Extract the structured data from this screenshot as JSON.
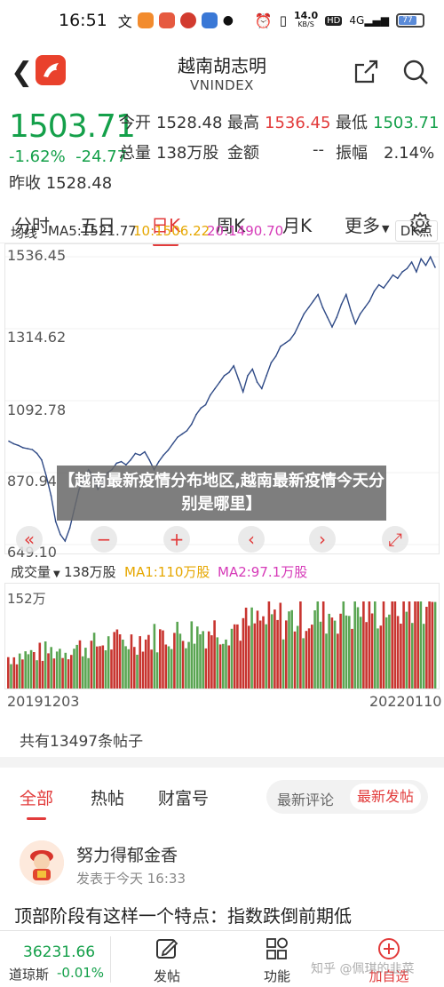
{
  "status": {
    "time": "16:51",
    "net_speed_top": "14.0",
    "net_speed_unit": "KB/S",
    "hd_label": "HD",
    "signal_label": "4G",
    "battery": "77"
  },
  "header": {
    "title": "越南胡志明",
    "subtitle": "VNINDEX"
  },
  "quote": {
    "price": "1503.71",
    "change_pct": "-1.62%",
    "change_abs": "-24.77",
    "prev_close_label": "昨收",
    "prev_close": "1528.48",
    "open_label": "今开",
    "open": "1528.48",
    "high_label": "最高",
    "high": "1536.45",
    "low_label": "最低",
    "low": "1503.71",
    "volume_label": "总量",
    "volume": "138万股",
    "amount_label": "金额",
    "amount": "--",
    "amplitude_label": "振幅",
    "amplitude": "2.14%"
  },
  "tabs": [
    "分时",
    "五日",
    "日K",
    "周K",
    "月K",
    "更多"
  ],
  "active_tab": "日K",
  "ma": {
    "label": "均线",
    "ma5": "MA5:1521.77",
    "ma10": "10:1506.22",
    "ma20": "20:1490.70",
    "dk_button": "DK点"
  },
  "colors": {
    "up": "#e23b3b",
    "down": "#14a04a",
    "ma10": "#f0b400",
    "ma20": "#d63ab8",
    "line": "#2f4a86"
  },
  "overlay_text": "【越南最新疫情分布地区,越南最新疫情今天分别是哪里】",
  "volume": {
    "label": "成交量",
    "value": "138万股",
    "ma1": "MA1:110万股",
    "ma2": "MA2:97.1万股",
    "max_label": "152万"
  },
  "dates": {
    "start": "20191203",
    "end": "20220110"
  },
  "chart_data": {
    "type": "line",
    "title": "",
    "xlabel": "",
    "ylabel": "",
    "ylim": [
      649.1,
      1536.45
    ],
    "y_ticks": [
      "1536.45",
      "1314.62",
      "1092.78",
      "870.94",
      "649.10"
    ],
    "x_range": [
      "20191203",
      "20220110"
    ],
    "values": [
      968,
      960,
      955,
      948,
      945,
      942,
      930,
      910,
      860,
      800,
      720,
      680,
      660,
      700,
      760,
      820,
      850,
      880,
      860,
      820,
      845,
      870,
      880,
      900,
      905,
      895,
      910,
      930,
      925,
      935,
      910,
      880,
      905,
      925,
      940,
      960,
      980,
      990,
      1000,
      1020,
      1050,
      1070,
      1080,
      1110,
      1130,
      1150,
      1170,
      1180,
      1200,
      1160,
      1120,
      1170,
      1190,
      1150,
      1130,
      1170,
      1210,
      1230,
      1260,
      1270,
      1280,
      1300,
      1330,
      1360,
      1380,
      1400,
      1420,
      1380,
      1350,
      1320,
      1350,
      1390,
      1420,
      1370,
      1330,
      1360,
      1380,
      1400,
      1430,
      1450,
      1440,
      1460,
      1480,
      1470,
      1490,
      1500,
      1520,
      1490,
      1530,
      1510,
      1536,
      1504
    ]
  },
  "posts": {
    "count_text": "共有13497条帖子",
    "filters": [
      "全部",
      "热帖",
      "财富号"
    ],
    "sort_options": [
      "最新评论",
      "最新发帖"
    ],
    "first_post": {
      "author": "努力得郁金香",
      "time": "发表于今天 16:33",
      "body": "顶部阶段有这样一个特点：指数跌倒前期低"
    }
  },
  "bottom_bar": {
    "index_value": "36231.66",
    "index_name": "道琼斯",
    "index_change": "-0.01%",
    "items": [
      "发帖",
      "功能",
      "加自选"
    ]
  },
  "watermark": "知乎 @佩琪的韭菜"
}
